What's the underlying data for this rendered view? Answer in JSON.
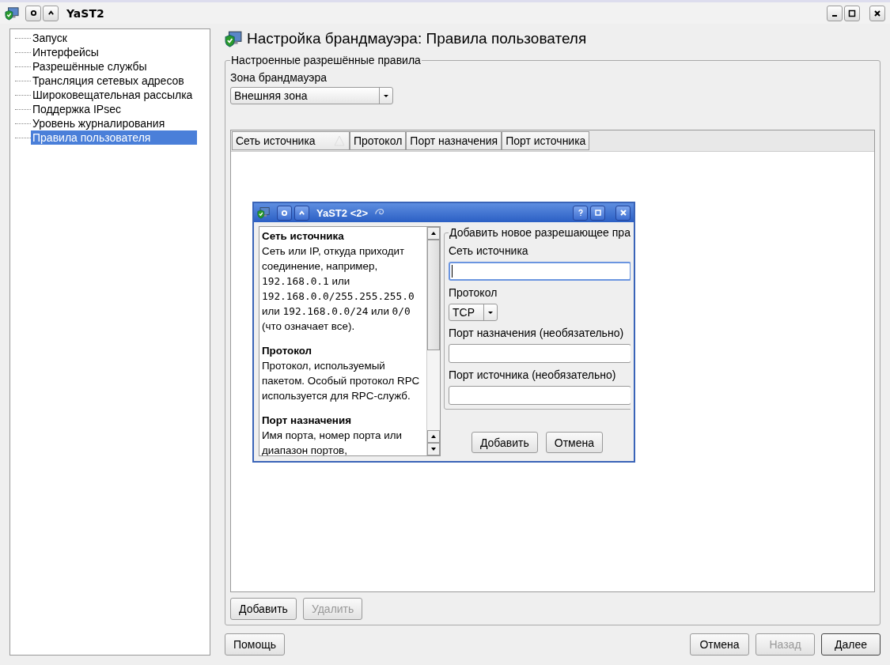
{
  "window": {
    "title": "YaST2"
  },
  "sidebar": {
    "items": [
      {
        "label": "Запуск",
        "selected": false
      },
      {
        "label": "Интерфейсы",
        "selected": false
      },
      {
        "label": "Разрешённые службы",
        "selected": false
      },
      {
        "label": "Трансляция сетевых адресов",
        "selected": false
      },
      {
        "label": "Широковещательная рассылка",
        "selected": false
      },
      {
        "label": "Поддержка IPsec",
        "selected": false
      },
      {
        "label": "Уровень журналирования",
        "selected": false
      },
      {
        "label": "Правила пользователя",
        "selected": true
      }
    ]
  },
  "page": {
    "title": "Настройка брандмауэра: Правила пользователя",
    "group_title": "Настроенные разрешённые правила",
    "zone": {
      "label": "Зона брандмауэра",
      "value": "Внешняя зона"
    },
    "table": {
      "columns": [
        {
          "label": "Сеть источника",
          "sorted": true
        },
        {
          "label": "Протокол",
          "sorted": false
        },
        {
          "label": "Порт назначения",
          "sorted": false
        },
        {
          "label": "Порт источника",
          "sorted": false
        }
      ]
    },
    "buttons": [
      {
        "label": "Добавить",
        "disabled": false
      },
      {
        "label": "Удалить",
        "disabled": true
      }
    ]
  },
  "footer": {
    "help": "Помощь",
    "buttons": [
      {
        "label": "Отмена",
        "disabled": false,
        "default": false
      },
      {
        "label": "Назад",
        "disabled": true,
        "default": false
      },
      {
        "label": "Далее",
        "disabled": false,
        "default": true
      }
    ]
  },
  "dialog": {
    "title": "YaST2 <2>",
    "help": [
      {
        "heading": "Сеть источника",
        "parts": [
          {
            "kind": "text",
            "text": "Сеть или IP, откуда приходит соединение, например, "
          },
          {
            "kind": "code",
            "text": "192.168.0.1"
          },
          {
            "kind": "text",
            "text": " или "
          },
          {
            "kind": "code",
            "text": "192.168.0.0/255.255.255.0"
          },
          {
            "kind": "text",
            "text": " или "
          },
          {
            "kind": "code",
            "text": "192.168.0.0/24"
          },
          {
            "kind": "text",
            "text": " или "
          },
          {
            "kind": "code",
            "text": "0/0"
          },
          {
            "kind": "text",
            "text": " (что означает все)."
          }
        ]
      },
      {
        "heading": "Протокол",
        "parts": [
          {
            "kind": "text",
            "text": "Протокол, используемый пакетом. Особый протокол RPC используется для RPC-служб."
          }
        ]
      },
      {
        "heading": "Порт назначения",
        "parts": [
          {
            "kind": "text",
            "text": "Имя порта, номер порта или диапазон портов,"
          }
        ]
      }
    ],
    "group_title": "Добавить новое разрешающее пра",
    "fields": [
      {
        "kind": "input",
        "label": "Сеть источника",
        "focused": true
      },
      {
        "kind": "combo",
        "label": "Протокол",
        "value": "TCP"
      },
      {
        "kind": "input",
        "label": "Порт назначения (необязательно)",
        "focused": false
      },
      {
        "kind": "input",
        "label": "Порт источника (необязательно)",
        "focused": false
      }
    ],
    "buttons": [
      "Добавить",
      "Отмена"
    ]
  }
}
